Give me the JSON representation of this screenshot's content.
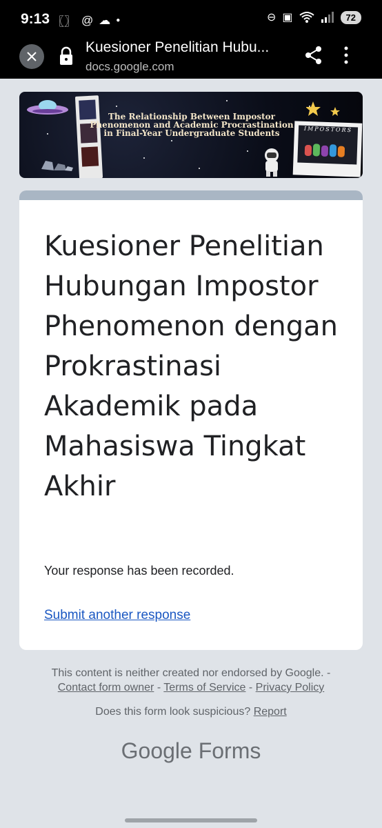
{
  "status_bar": {
    "time": "9:13",
    "left_icons": [
      "vibrate-icon",
      "at-icon",
      "cloud-icon",
      "dot-icon"
    ],
    "right_icons": [
      "dnd-icon",
      "nfc-icon",
      "wifi-icon",
      "signal-icon"
    ],
    "battery": "72"
  },
  "browser": {
    "page_title": "Kuesioner Penelitian Hubu...",
    "domain": "docs.google.com"
  },
  "banner": {
    "title": "The Relationship Between Impostor Phenomenon and Academic Procrastination in Final-Year Undergraduate Students",
    "polaroid_text": "IMPOSTORS"
  },
  "form": {
    "title": "Kuesioner Penelitian Hubungan Impostor Phenomenon dengan Prokrastinasi Akademik pada Mahasiswa Tingkat Akhir",
    "response_message": "Your response has been recorded.",
    "submit_another": "Submit another response",
    "header_color": "#a9b6c4",
    "link_color": "#1a57c2"
  },
  "footer": {
    "disclaimer": "This content is neither created nor endorsed by Google. -",
    "contact_owner": "Contact form owner",
    "terms": "Terms of Service",
    "privacy": "Privacy Policy",
    "separator": "-",
    "suspicious_text": "Does this form look suspicious?",
    "report": "Report",
    "brand_google": "Google",
    "brand_forms": "Forms"
  }
}
